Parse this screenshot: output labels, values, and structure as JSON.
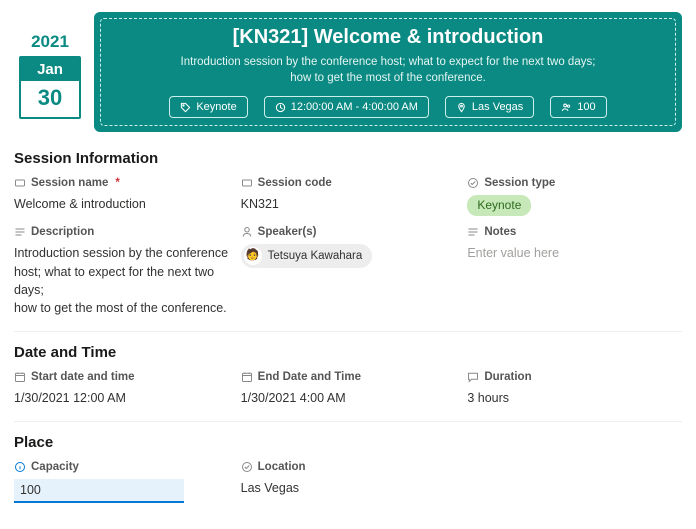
{
  "date": {
    "year": "2021",
    "month": "Jan",
    "day": "30"
  },
  "banner": {
    "title": "[KN321] Welcome & introduction",
    "subtitle": "Introduction session by the conference host; what to expect for the next two days;\nhow to get the most of the conference.",
    "chips": {
      "keynote": "Keynote",
      "time": "12:00:00 AM - 4:00:00 AM",
      "place": "Las Vegas",
      "capacity": "100"
    }
  },
  "sections": {
    "info": {
      "title": "Session Information",
      "session_name_label": "Session name",
      "session_name": "Welcome & introduction",
      "session_code_label": "Session code",
      "session_code": "KN321",
      "session_type_label": "Session type",
      "session_type": "Keynote",
      "description_label": "Description",
      "description": "Introduction session by the conference host; what to expect for the next two days;\nhow to get the most of the conference.",
      "speakers_label": "Speaker(s)",
      "speaker": "Tetsuya Kawahara",
      "notes_label": "Notes",
      "notes_placeholder": "Enter value here"
    },
    "datetime": {
      "title": "Date and Time",
      "start_label": "Start date and time",
      "start": "1/30/2021 12:00 AM",
      "end_label": "End Date and Time",
      "end": "1/30/2021 4:00 AM",
      "duration_label": "Duration",
      "duration": "3 hours"
    },
    "place": {
      "title": "Place",
      "capacity_label": "Capacity",
      "capacity": "100",
      "location_label": "Location",
      "location": "Las Vegas"
    }
  }
}
